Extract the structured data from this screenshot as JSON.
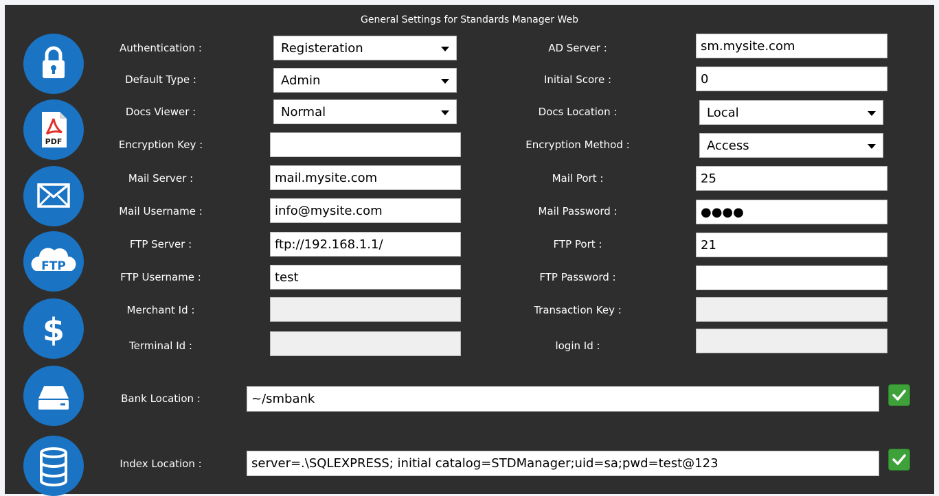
{
  "window": {
    "title": "General Settings for Standards Manager Web"
  },
  "icons": [
    {
      "name": "lock-icon"
    },
    {
      "name": "pdf-icon",
      "text": "PDF"
    },
    {
      "name": "mail-icon"
    },
    {
      "name": "ftp-icon",
      "text": "FTP"
    },
    {
      "name": "dollar-icon",
      "text": "$"
    },
    {
      "name": "drive-icon"
    },
    {
      "name": "database-icon"
    }
  ],
  "colors": {
    "accent": "#1a73c3",
    "panel": "#2e2e2e",
    "ok": "#3ea13a"
  },
  "left": {
    "authentication": {
      "label": "Authentication :",
      "value": "Registeration"
    },
    "default_type": {
      "label": "Default Type :",
      "value": "Admin"
    },
    "docs_viewer": {
      "label": "Docs Viewer :",
      "value": "Normal"
    },
    "encryption_key": {
      "label": "Encryption Key :",
      "value": ""
    },
    "mail_server": {
      "label": "Mail Server :",
      "value": "mail.mysite.com"
    },
    "mail_username": {
      "label": "Mail Username :",
      "value": "info@mysite.com"
    },
    "ftp_server": {
      "label": "FTP Server :",
      "value": "ftp://192.168.1.1/"
    },
    "ftp_username": {
      "label": "FTP Username :",
      "value": "test"
    },
    "merchant_id": {
      "label": "Merchant Id :",
      "value": ""
    },
    "terminal_id": {
      "label": "Terminal Id :",
      "value": ""
    }
  },
  "right": {
    "ad_server": {
      "label": "AD Server :",
      "value": "sm.mysite.com"
    },
    "initial_score": {
      "label": "Initial Score :",
      "value": "0"
    },
    "docs_location": {
      "label": "Docs Location :",
      "value": "Local"
    },
    "encryption_method": {
      "label": "Encryption Method :",
      "value": "Access"
    },
    "mail_port": {
      "label": "Mail Port :",
      "value": "25"
    },
    "mail_password": {
      "label": "Mail Password :",
      "value": "●●●●"
    },
    "ftp_port": {
      "label": "FTP Port :",
      "value": "21"
    },
    "ftp_password": {
      "label": "FTP Password :",
      "value": ""
    },
    "transaction_key": {
      "label": "Transaction Key :",
      "value": ""
    },
    "login_id": {
      "label": "login Id :",
      "value": ""
    }
  },
  "bank_location": {
    "label": "Bank Location :",
    "value": "~/smbank"
  },
  "index_location": {
    "label": "Index Location :",
    "value": "server=.\\SQLEXPRESS; initial catalog=STDManager;uid=sa;pwd=test@123"
  }
}
